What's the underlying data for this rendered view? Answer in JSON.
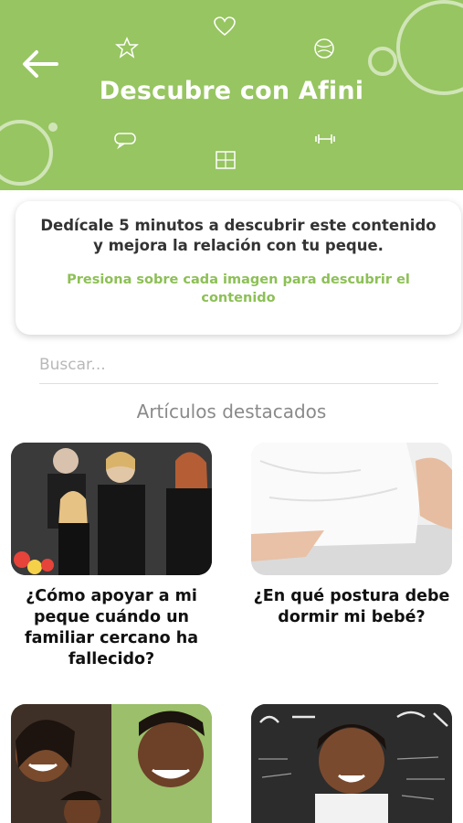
{
  "header": {
    "title": "Descubre con Afini",
    "back_icon": "arrow-left-icon",
    "bg_color": "#97c561"
  },
  "info": {
    "main_text": "Dedícale 5 minutos a descubrir este contenido y mejora la relación con tu peque.",
    "hint_text": "Presiona sobre cada imagen para descubrir el contenido",
    "hint_color": "#8dc056"
  },
  "search": {
    "placeholder": "Buscar...",
    "value": ""
  },
  "section": {
    "title": "Artículos destacados"
  },
  "articles": [
    {
      "caption": "¿Cómo apoyar a mi peque cuándo un familiar cercano ha fallecido?",
      "image": "funeral-family-photo"
    },
    {
      "caption": "¿En qué postura debe dormir mi bebé?",
      "image": "sleeping-baby-photo"
    },
    {
      "caption": "",
      "image": "smiling-family-photo"
    },
    {
      "caption": "",
      "image": "boy-chalkboard-photo"
    }
  ]
}
